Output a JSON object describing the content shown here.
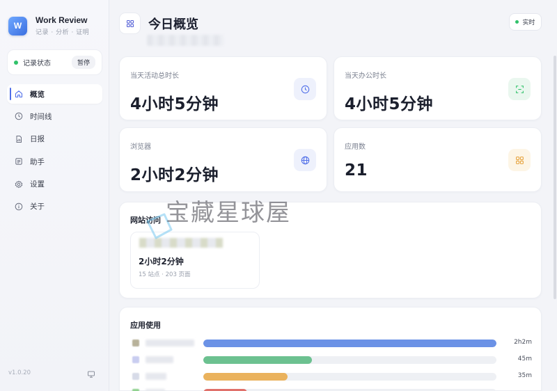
{
  "brand": {
    "title": "Work Review",
    "subtitle": "记录 · 分析 · 证明",
    "logo_letter": "W"
  },
  "record": {
    "label": "记录状态",
    "pause_label": "暂停",
    "status_color": "#31c26a"
  },
  "nav": {
    "items": [
      {
        "label": "概览",
        "icon": "home-icon",
        "active": true
      },
      {
        "label": "时间线",
        "icon": "clock-icon",
        "active": false
      },
      {
        "label": "日报",
        "icon": "report-icon",
        "active": false
      },
      {
        "label": "助手",
        "icon": "assistant-icon",
        "active": false
      },
      {
        "label": "设置",
        "icon": "gear-icon",
        "active": false
      },
      {
        "label": "关于",
        "icon": "info-icon",
        "active": false
      }
    ]
  },
  "footer": {
    "version": "v1.0.20"
  },
  "header": {
    "title": "今日概览",
    "live_label": "实时"
  },
  "stats": [
    {
      "label": "当天活动总时长",
      "value": "4小时5分钟",
      "icon": "clock-icon",
      "icon_bg": "#eef1fc",
      "icon_color": "#4f6ee8"
    },
    {
      "label": "当天办公时长",
      "value": "4小时5分钟",
      "icon": "scan-icon",
      "icon_bg": "#eaf7ef",
      "icon_color": "#31c26a"
    },
    {
      "label": "浏览器",
      "value": "2小时2分钟",
      "icon": "globe-icon",
      "icon_bg": "#eef1fc",
      "icon_color": "#4f6ee8"
    },
    {
      "label": "应用数",
      "value": "21",
      "icon": "apps-icon",
      "icon_bg": "#fdf5e6",
      "icon_color": "#e6a23c"
    }
  ],
  "websites": {
    "title": "网站访问",
    "card": {
      "time": "2小时2分钟",
      "meta": "15 站点 · 203 页面"
    }
  },
  "apps": {
    "title": "应用使用",
    "rows": [
      {
        "time": "2h2m",
        "fraction": 1.0,
        "color": "#6b92e6",
        "swatch": "#b8b29a"
      },
      {
        "time": "45m",
        "fraction": 0.37,
        "color": "#6cc190",
        "swatch": "#c9cdf0"
      },
      {
        "time": "35m",
        "fraction": 0.287,
        "color": "#eab25d",
        "swatch": "#d7dbe8"
      },
      {
        "time": "",
        "fraction": 0.15,
        "color": "#e0706a",
        "swatch": "#8fd18f"
      }
    ]
  },
  "watermark": {
    "text": "宝藏星球屋"
  }
}
